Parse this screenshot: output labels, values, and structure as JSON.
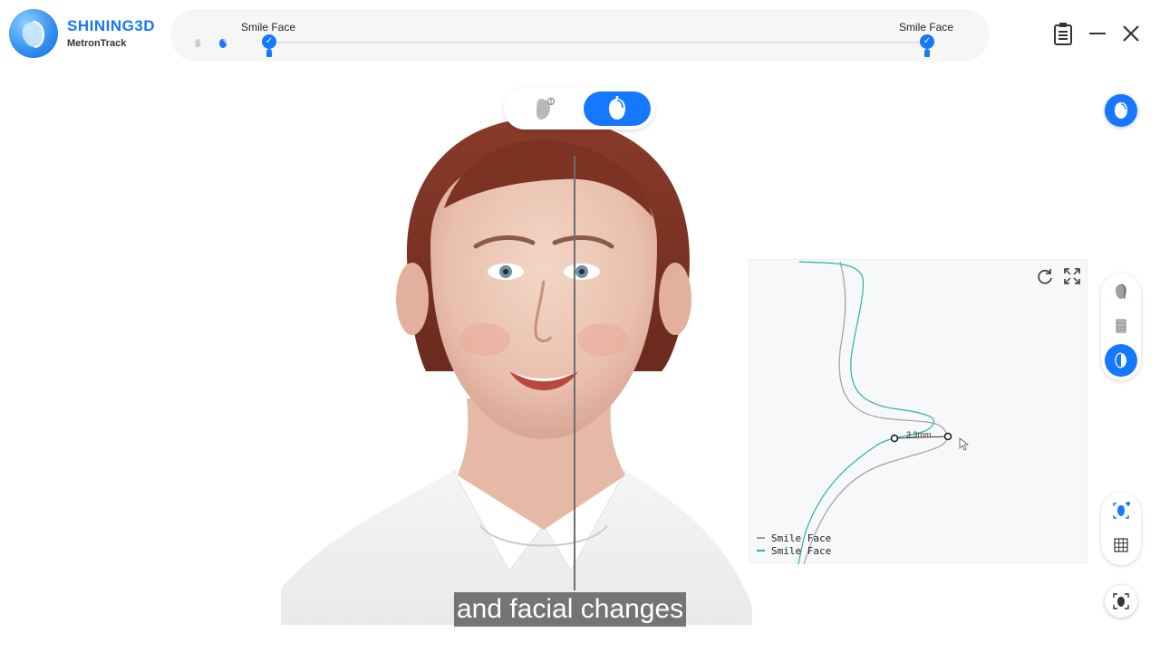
{
  "app": {
    "brand_name": "SHINING3D",
    "brand_sub": "MetronTrack"
  },
  "timeline": {
    "start_label": "Smile Face",
    "end_label": "Smile Face"
  },
  "window_controls": {
    "report_icon": "clipboard-icon",
    "minimize_icon": "minimize-icon",
    "close_icon": "close-icon"
  },
  "view_toggle": {
    "options": [
      "face-profile-view",
      "face-front-view"
    ],
    "active": "face-front-view"
  },
  "profile_panel": {
    "measurement": "3.3mm",
    "legend": [
      {
        "name": "Smile Face",
        "color": "#9aa0a6"
      },
      {
        "name": "Smile Face",
        "color": "#2bb39a"
      }
    ]
  },
  "caption": {
    "text": "and facial changes"
  },
  "colors": {
    "accent": "#1677ff",
    "curve_gray": "#9aa0a6",
    "curve_green": "#2bb39a"
  }
}
